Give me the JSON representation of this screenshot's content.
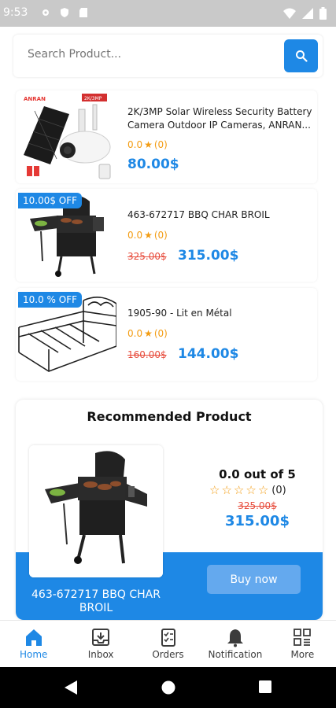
{
  "status_bar": {
    "time": "9:53"
  },
  "search": {
    "placeholder": "Search Product..."
  },
  "products": [
    {
      "name": "2K/3MP Solar Wireless Security Battery Camera Outdoor IP Cameras, ANRAN...",
      "rating": "0.0",
      "count": "(0)",
      "price": "80.00$",
      "badge_brand": "ANRAN",
      "badge_res": "2K/3MP"
    },
    {
      "badge": "10.00$ OFF",
      "name": "463-672717 BBQ CHAR BROIL",
      "rating": "0.0",
      "count": "(0)",
      "old_price": "325.00$",
      "price": "315.00$"
    },
    {
      "badge": "10.0 % OFF",
      "name": "1905-90 - Lit en Métal",
      "rating": "0.0",
      "count": "(0)",
      "old_price": "160.00$",
      "price": "144.00$"
    }
  ],
  "recommended": {
    "title": "Recommended Product",
    "name": "463-672717 BBQ CHAR BROIL",
    "rating_text": "0.0 out of 5",
    "count": "(0)",
    "old_price": "325.00$",
    "price": "315.00$",
    "buy_label": "Buy now"
  },
  "nav": [
    {
      "label": "Home",
      "icon": "home-icon",
      "active": true
    },
    {
      "label": "Inbox",
      "icon": "inbox-icon"
    },
    {
      "label": "Orders",
      "icon": "orders-icon"
    },
    {
      "label": "Notification",
      "icon": "bell-icon"
    },
    {
      "label": "More",
      "icon": "grid-icon"
    }
  ],
  "colors": {
    "accent": "#1e88e5",
    "star": "#f39c12",
    "old_price": "#e74c3c"
  }
}
